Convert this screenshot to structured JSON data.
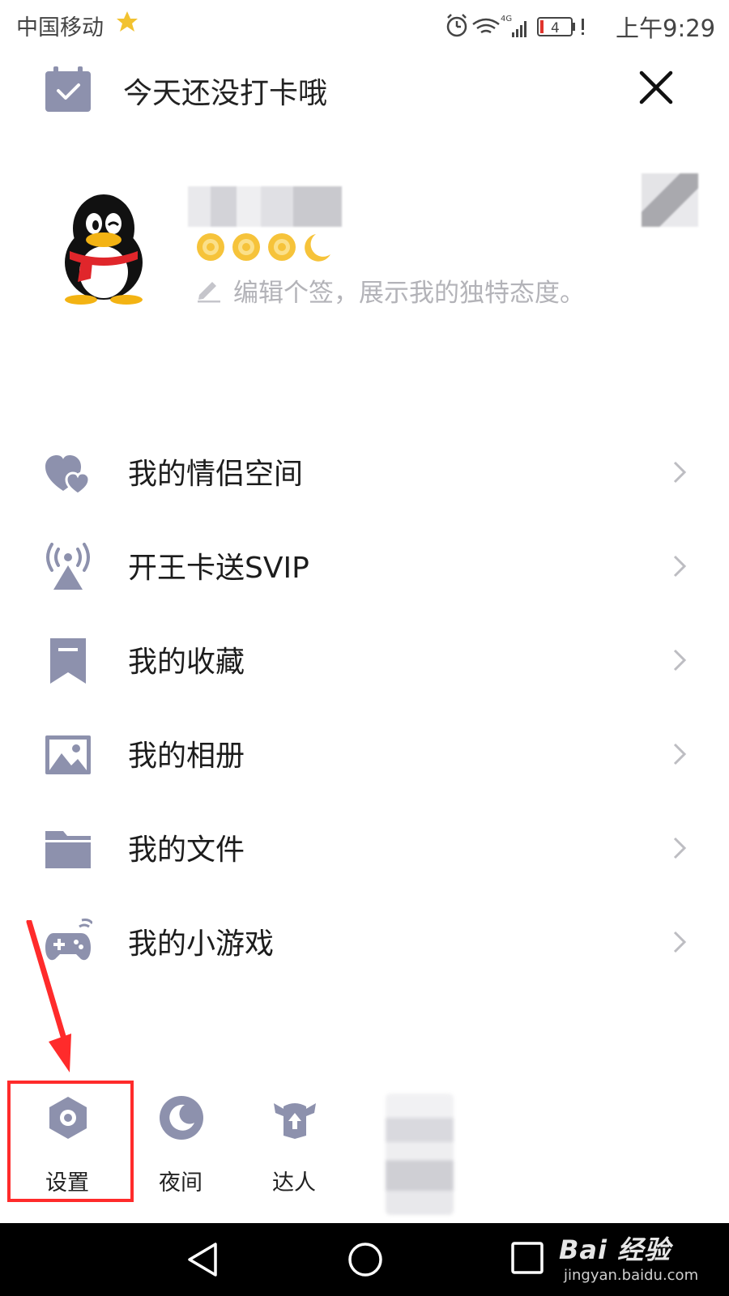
{
  "status_bar": {
    "carrier": "中国移动",
    "network": "4G",
    "battery": "4",
    "time": "上午9:29"
  },
  "header": {
    "checkin_text": "今天还没打卡哦"
  },
  "profile": {
    "signature_placeholder": "编辑个签，展示我的独特态度。"
  },
  "menu": {
    "items": [
      {
        "label": "我的情侣空间",
        "icon": "hearts-icon"
      },
      {
        "label": "开王卡送SVIP",
        "icon": "signal-tower-icon"
      },
      {
        "label": "我的收藏",
        "icon": "bookmark-icon"
      },
      {
        "label": "我的相册",
        "icon": "image-icon"
      },
      {
        "label": "我的文件",
        "icon": "folder-icon"
      },
      {
        "label": "我的小游戏",
        "icon": "gamepad-icon"
      }
    ]
  },
  "bottom_bar": {
    "settings_label": "设置",
    "night_label": "夜间",
    "expert_label": "达人"
  },
  "watermark": {
    "brand": "Bai 经验",
    "url": "jingyan.baidu.com"
  },
  "colors": {
    "icon": "#8d91ad",
    "annotation": "#ff2b2b",
    "nav_bar": "#000000"
  }
}
